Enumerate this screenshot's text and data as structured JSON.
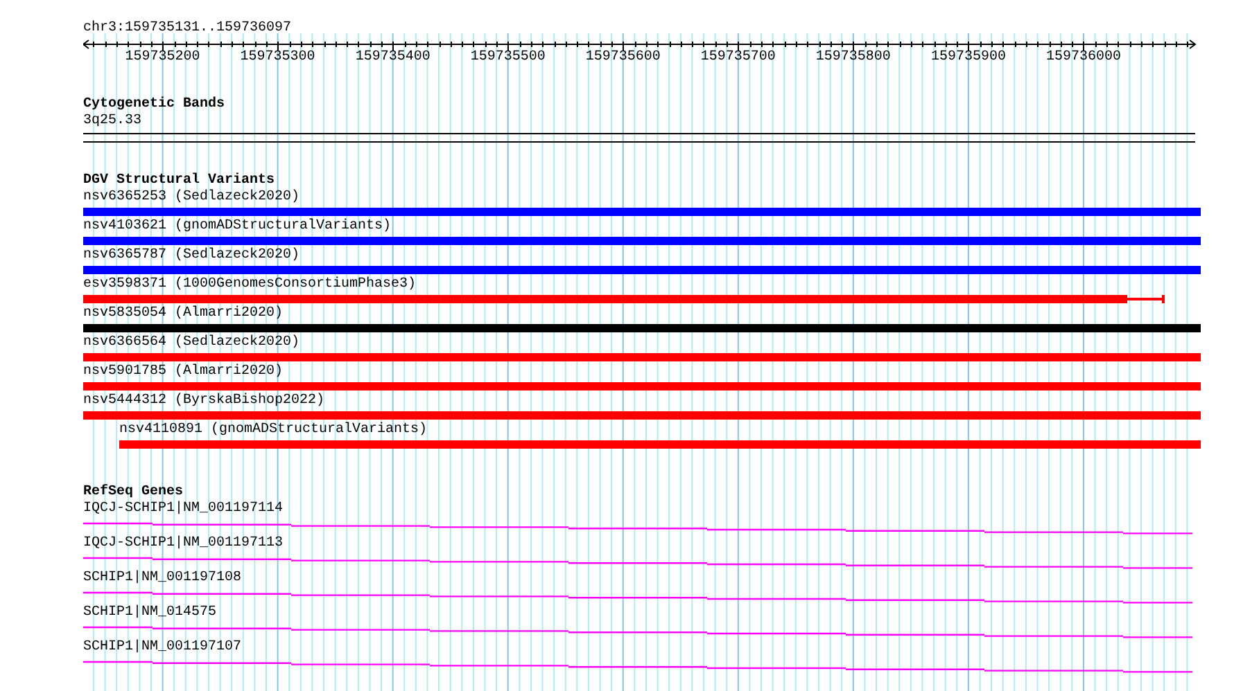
{
  "ruler": {
    "range": "chr3:159735131..159736097",
    "tick_labels": [
      "159735200",
      "159735300",
      "159735400",
      "159735500",
      "159735600",
      "159735700",
      "159735800",
      "159735900",
      "159736000"
    ]
  },
  "tracks": [
    {
      "kind": "cytoband",
      "title": "Cytogenetic Bands",
      "features": [
        {
          "label": "3q25.33"
        }
      ]
    },
    {
      "kind": "variants",
      "title": "DGV Structural Variants",
      "features": [
        {
          "label": "nsv6365253 (Sedlazeck2020)",
          "color": "#0000ff",
          "whisker": false,
          "indented": false
        },
        {
          "label": "nsv4103621 (gnomADStructuralVariants)",
          "color": "#0000ff",
          "whisker": false,
          "indented": false
        },
        {
          "label": "nsv6365787 (Sedlazeck2020)",
          "color": "#0000ff",
          "whisker": false,
          "indented": false
        },
        {
          "label": "esv3598371 (1000GenomesConsortiumPhase3)",
          "color": "#ff0000",
          "whisker": true,
          "indented": false
        },
        {
          "label": "nsv5835054 (Almarri2020)",
          "color": "#000000",
          "whisker": false,
          "indented": false
        },
        {
          "label": "nsv6366564 (Sedlazeck2020)",
          "color": "#ff0000",
          "whisker": false,
          "indented": false
        },
        {
          "label": "nsv5901785 (Almarri2020)",
          "color": "#ff0000",
          "whisker": false,
          "indented": false
        },
        {
          "label": "nsv5444312 (ByrskaBishop2022)",
          "color": "#ff0000",
          "whisker": false,
          "indented": false
        },
        {
          "label": "nsv4110891 (gnomADStructuralVariants)",
          "color": "#ff0000",
          "whisker": false,
          "indented": true
        }
      ]
    },
    {
      "kind": "genes",
      "title": "RefSeq Genes",
      "features": [
        {
          "label": "IQCJ-SCHIP1|NM_001197114"
        },
        {
          "label": "IQCJ-SCHIP1|NM_001197113"
        },
        {
          "label": "SCHIP1|NM_001197108"
        },
        {
          "label": "SCHIP1|NM_014575"
        },
        {
          "label": "SCHIP1|NM_001197107"
        }
      ]
    }
  ]
}
